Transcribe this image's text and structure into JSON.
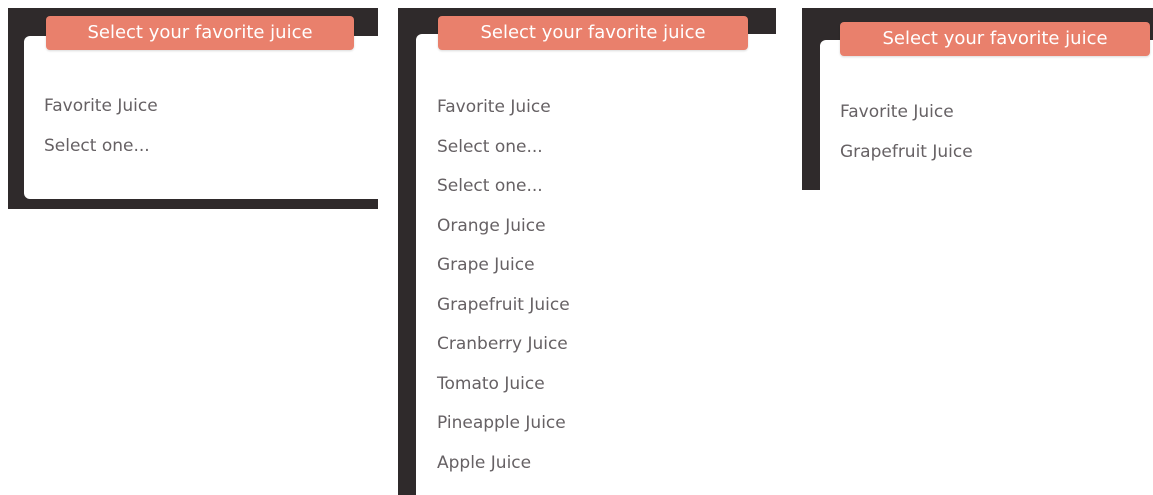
{
  "colors": {
    "frame": "#2f2a2b",
    "title_bg": "#e9806c",
    "title_text": "#ffffff",
    "text": "#666164",
    "panel_bg": "#ffffff"
  },
  "panels": [
    {
      "title": "Select your favorite juice",
      "field_label": "Favorite Juice",
      "select_value": "Select one..."
    },
    {
      "title": "Select your favorite juice",
      "field_label": "Favorite Juice",
      "select_value": "Select one...",
      "options": [
        "Select one...",
        "Orange Juice",
        "Grape Juice",
        "Grapefruit Juice",
        "Cranberry Juice",
        "Tomato Juice",
        "Pineapple Juice",
        "Apple Juice"
      ]
    },
    {
      "title": "Select your favorite juice",
      "field_label": "Favorite Juice",
      "select_value": "Grapefruit Juice"
    }
  ]
}
